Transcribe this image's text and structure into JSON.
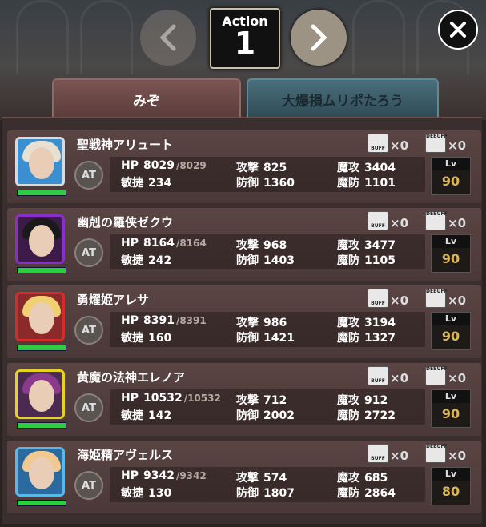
{
  "header": {
    "action_label": "Action",
    "action_number": "1",
    "prev_icon": "chevron-left-icon",
    "next_icon": "chevron-right-icon",
    "close_icon": "close-icon"
  },
  "tabs": [
    {
      "label": "みぞ",
      "active": true
    },
    {
      "label": "大爆損ムリポたろう",
      "active": false
    }
  ],
  "labels": {
    "hp": "HP",
    "agi": "敏捷",
    "atk": "攻撃",
    "def": "防御",
    "matk": "魔攻",
    "mdef": "魔防",
    "at": "AT",
    "lv": "Lv",
    "buff": "BUFF",
    "debuff": "DEBUFF"
  },
  "units": [
    {
      "name": "聖戦神アリュート",
      "hp": "8029",
      "hp_max": "/8029",
      "agi": "234",
      "atk": "825",
      "def": "1360",
      "matk": "3404",
      "mdef": "1101",
      "lv": "90",
      "buff": "×0",
      "debuff": "×0",
      "frame": "#d9d9d9",
      "hair": "#e8e0d0",
      "bg": "#3a8fd0",
      "hp_fill": 1.0
    },
    {
      "name": "幽剋の羅侠ゼクウ",
      "hp": "8164",
      "hp_max": "/8164",
      "agi": "242",
      "atk": "968",
      "def": "1403",
      "matk": "3477",
      "mdef": "1105",
      "lv": "90",
      "buff": "×0",
      "debuff": "×0",
      "frame": "#8a2fc9",
      "hair": "#1a1a1a",
      "bg": "#3c1a4a",
      "hp_fill": 1.0
    },
    {
      "name": "勇燿姫アレサ",
      "hp": "8391",
      "hp_max": "/8391",
      "agi": "160",
      "atk": "986",
      "def": "1421",
      "matk": "3194",
      "mdef": "1327",
      "lv": "90",
      "buff": "×0",
      "debuff": "×0",
      "frame": "#d62b2b",
      "hair": "#f0d070",
      "bg": "#8a2a2a",
      "hp_fill": 1.0
    },
    {
      "name": "黄魔の法神エレノア",
      "hp": "10532",
      "hp_max": "/10532",
      "agi": "142",
      "atk": "712",
      "def": "2002",
      "matk": "912",
      "mdef": "2722",
      "lv": "90",
      "buff": "×0",
      "debuff": "×0",
      "frame": "#e8d21e",
      "hair": "#8a3a8a",
      "bg": "#4a2a50",
      "hp_fill": 1.0
    },
    {
      "name": "海姫精アヴェルス",
      "hp": "9342",
      "hp_max": "/9342",
      "agi": "130",
      "atk": "574",
      "def": "1807",
      "matk": "685",
      "mdef": "2864",
      "lv": "80",
      "buff": "×0",
      "debuff": "×0",
      "frame": "#5ab8e8",
      "hair": "#f0c890",
      "bg": "#2a6aa0",
      "hp_fill": 1.0
    }
  ]
}
